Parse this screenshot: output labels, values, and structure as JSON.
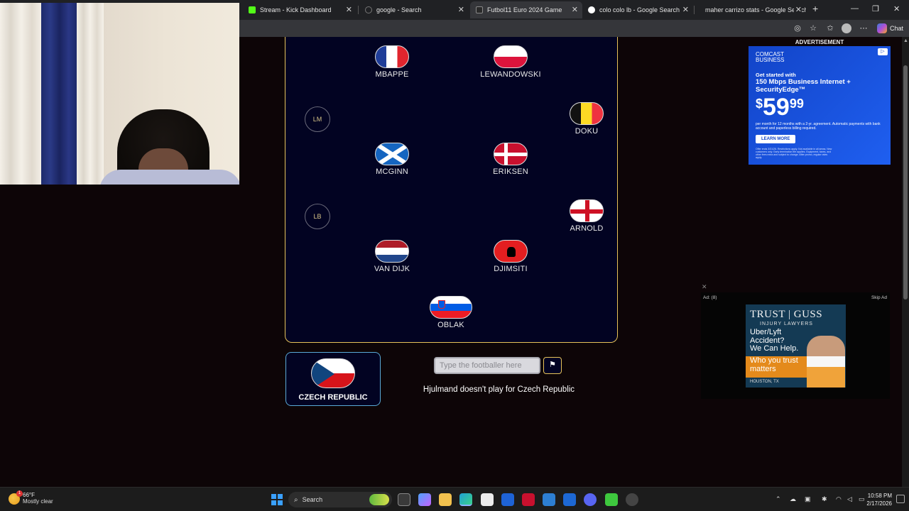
{
  "browser": {
    "tabs": [
      {
        "title": "Stream - Kick Dashboard",
        "favicon_color": "#53fc18",
        "active": false
      },
      {
        "title": "google - Search",
        "favicon_color": "#555555",
        "active": false
      },
      {
        "title": "Futbol11 Euro 2024 Game",
        "favicon_color": "#2a2a2a",
        "active": true
      },
      {
        "title": "colo colo lb - Google Search",
        "favicon_color": "#4285f4",
        "active": false
      },
      {
        "title": "maher carrizo stats - Google Search",
        "favicon_color": "#4285f4",
        "active": false
      }
    ],
    "new_tab": "+",
    "chat_label": "Chat"
  },
  "game": {
    "players": [
      {
        "name": "MBAPPE",
        "flag": "fr"
      },
      {
        "name": "LEWANDOWSKI",
        "flag": "pl"
      },
      {
        "name": "DOKU",
        "flag": "be"
      },
      {
        "name": "MCGINN",
        "flag": "sc"
      },
      {
        "name": "ERIKSEN",
        "flag": "dk"
      },
      {
        "name": "ARNOLD",
        "flag": "en"
      },
      {
        "name": "VAN DIJK",
        "flag": "nl"
      },
      {
        "name": "DJIMSITI",
        "flag": "al"
      },
      {
        "name": "OBLAK",
        "flag": "si"
      }
    ],
    "empty_slots": [
      "LM",
      "LB"
    ],
    "country": {
      "name": "CZECH REPUBLIC",
      "flag": "cz"
    },
    "input_placeholder": "Type the footballer here",
    "flag_button_icon": "⚑",
    "message": "Hjulmand doesn't play for Czech Republic",
    "accent_color": "#e7c35a"
  },
  "ads": {
    "label": "ADVERTISEMENT",
    "comcast": {
      "brand_line1": "COMCAST",
      "brand_line2": "BUSINESS",
      "headline1": "Get started with",
      "headline2": "150 Mbps Business Internet +",
      "headline3": "SecurityEdge™",
      "price_dollar": "$",
      "price_main": "59",
      "price_cents": "99",
      "fine": "per month for 12 months with a 2-yr. agreement. Automatic payments with bank account and paperless billing required.",
      "cta": "LEARN MORE",
      "tiny": "Offer ends 3/31/26. Restrictions apply. Not available in all areas. New customers only. Early termination fee applies. Equipment, taxes, and other fees extra and subject to change. After promo, regular rates apply."
    },
    "video": {
      "counter": "Ad: (8)",
      "skip": "Skip Ad",
      "close": "✕",
      "brand": "TRUST | GUSS",
      "brand_sub": "INJURY LAWYERS",
      "copy_line1": "Uber/Lyft",
      "copy_line2": "Accident?",
      "copy_line3": "We Can Help.",
      "band_line1": "Who you trust",
      "band_line2": "matters",
      "location": "HOUSTON, TX"
    }
  },
  "taskbar": {
    "weather_temp": "66°F",
    "weather_cond": "Mostly clear",
    "search_label": "Search",
    "time": "10:58 PM",
    "date": "2/17/2026"
  }
}
